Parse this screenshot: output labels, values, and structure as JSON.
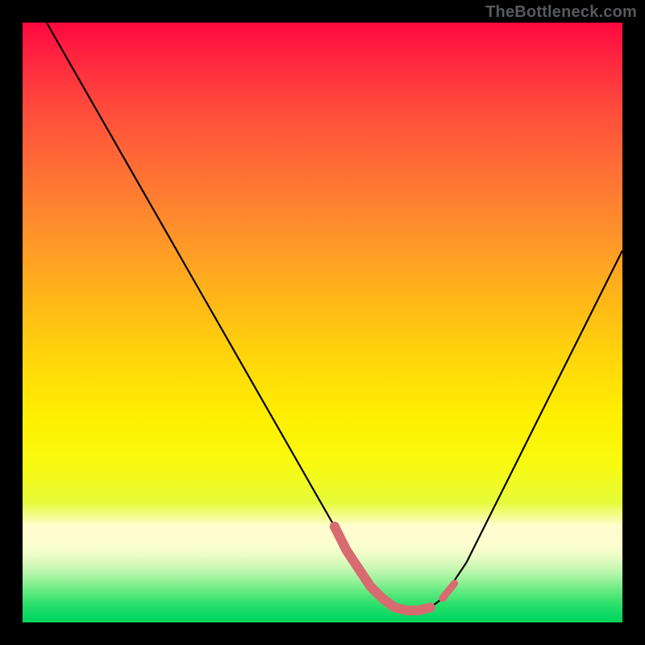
{
  "attribution_text": "TheBottleneck.com",
  "chart_data": {
    "type": "line",
    "title": "",
    "xlabel": "",
    "ylabel": "",
    "xlim": [
      0,
      100
    ],
    "ylim": [
      0,
      100
    ],
    "series": [
      {
        "name": "bottleneck-curve",
        "x": [
          4,
          8,
          12,
          16,
          20,
          24,
          28,
          32,
          36,
          40,
          44,
          48,
          52,
          54,
          56,
          58,
          60,
          62,
          64,
          66,
          68,
          70,
          74,
          78,
          82,
          86,
          90,
          94,
          98,
          100
        ],
        "y": [
          100,
          93,
          86,
          79,
          72,
          65,
          58,
          51,
          44,
          37,
          30,
          23,
          16,
          12,
          9,
          6,
          4,
          2.5,
          2,
          2,
          2.5,
          4,
          10,
          18,
          26,
          34,
          42,
          50,
          58,
          62
        ]
      }
    ],
    "accent_segments": [
      {
        "name": "valley-left",
        "x": [
          52,
          54,
          56,
          58
        ],
        "y": [
          16,
          12,
          9,
          6
        ]
      },
      {
        "name": "valley-floor",
        "x": [
          58,
          60,
          62,
          64,
          66,
          68
        ],
        "y": [
          6,
          4,
          2.5,
          2,
          2,
          2.5
        ]
      },
      {
        "name": "valley-right",
        "x": [
          70,
          72
        ],
        "y": [
          4,
          6.5
        ]
      }
    ],
    "gradient_stops": [
      {
        "offset": 0,
        "color": "#ff083f"
      },
      {
        "offset": 50,
        "color": "#ffd60b"
      },
      {
        "offset": 85,
        "color": "#fffdd0"
      },
      {
        "offset": 100,
        "color": "#00d45c"
      }
    ]
  }
}
